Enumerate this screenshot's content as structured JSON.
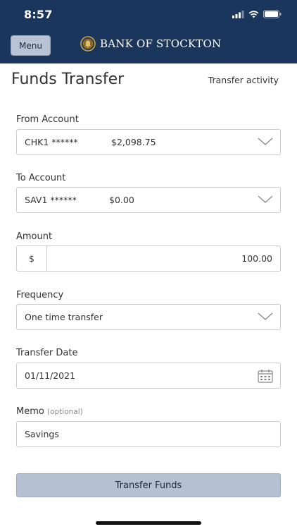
{
  "status_bar": {
    "time": "8:57"
  },
  "nav": {
    "menu_label": "Menu",
    "brand": "BANK OF STOCKTON"
  },
  "page": {
    "title": "Funds Transfer",
    "activity_link": "Transfer activity"
  },
  "from_account": {
    "label": "From Account",
    "account": "CHK1 ******",
    "balance": "$2,098.75"
  },
  "to_account": {
    "label": "To Account",
    "account": "SAV1 ******",
    "balance": "$0.00"
  },
  "amount": {
    "label": "Amount",
    "currency_symbol": "$",
    "value": "100.00"
  },
  "frequency": {
    "label": "Frequency",
    "value": "One time transfer"
  },
  "transfer_date": {
    "label": "Transfer Date",
    "value": "01/11/2021"
  },
  "memo": {
    "label": "Memo",
    "optional_hint": "(optional)",
    "value": "Savings"
  },
  "submit": {
    "label": "Transfer Funds"
  },
  "colors": {
    "header_bg": "#1b365d",
    "button_bg": "#b5c1d3",
    "border": "#c9ccd1"
  }
}
